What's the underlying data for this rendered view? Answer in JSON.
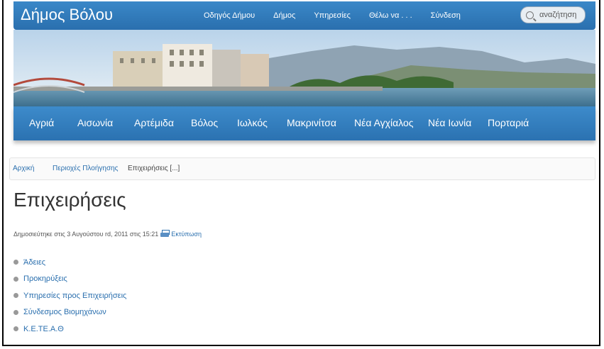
{
  "caption": "… δήμου Βόλου: Περιοχές Πλοήγησης …",
  "header": {
    "site_title": "Δήμος Βόλου",
    "nav": [
      "Οδηγός Δήμου",
      "Δήμος",
      "Υπηρεσίες",
      "Θέλω να . . .",
      "Σύνδεση"
    ],
    "search_placeholder": "αναζήτηση"
  },
  "cities": [
    "Αγριά",
    "Αισωνία",
    "Αρτέμιδα",
    "Βόλος",
    "Ιωλκός",
    "Μακρινίτσα",
    "Νέα Αγχίαλος",
    "Νέα Ιωνία",
    "Πορταριά"
  ],
  "breadcrumb": {
    "home": "Αρχική",
    "section": "Περιοχές Πλοήγησης",
    "current": "Επιχειρήσεις [...]"
  },
  "page": {
    "title": "Επιχειρήσεις",
    "published": "Δημοσιεύτηκε στις 3 Αυγούστου rd, 2011 στις 15:21",
    "print_label": "Εκτύπωση"
  },
  "items": [
    "Άδειες",
    "Προκηρύξεις",
    "Υπηρεσίες προς Επιχειρήσεις",
    "Σύνδεσμος Βιομηχάνων",
    "Κ.Ε.ΤΕ.Α.Θ"
  ],
  "colors": {
    "nav_blue": "#2f7bbd",
    "link_blue": "#2a6fae"
  }
}
